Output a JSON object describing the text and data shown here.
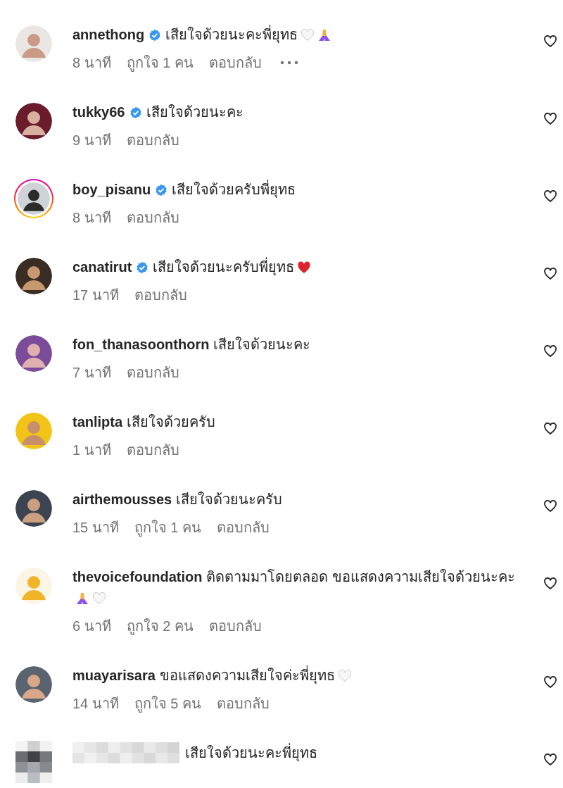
{
  "comments": [
    {
      "username": "annethong",
      "verified": true,
      "story_ring": false,
      "text": "เสียใจด้วยนะคะพี่ยุทธ",
      "emojis": [
        {
          "kind": "white-heart"
        },
        {
          "kind": "folded-hands"
        }
      ],
      "time": "8 นาที",
      "likes": "ถูกใจ 1 คน",
      "reply": "ตอบกลับ",
      "more_menu": true
    },
    {
      "username": "tukky66",
      "verified": true,
      "story_ring": false,
      "text": "เสียใจด้วยนะคะ",
      "time": "9 นาที",
      "reply": "ตอบกลับ",
      "more_menu": false
    },
    {
      "username": "boy_pisanu",
      "verified": true,
      "story_ring": true,
      "text": "เสียใจด้วยครับพี่ยุทธ",
      "time": "8 นาที",
      "reply": "ตอบกลับ",
      "more_menu": false
    },
    {
      "username": "canatirut",
      "verified": true,
      "story_ring": false,
      "text": "เสียใจด้วยนะครับพี่ยุทธ",
      "emojis": [
        {
          "kind": "red-heart"
        }
      ],
      "time": "17 นาที",
      "reply": "ตอบกลับ",
      "more_menu": false
    },
    {
      "username": "fon_thanasoonthorn",
      "verified": false,
      "story_ring": false,
      "text": "เสียใจด้วยนะคะ",
      "time": "7 นาที",
      "reply": "ตอบกลับ",
      "more_menu": false
    },
    {
      "username": "tanlipta",
      "verified": false,
      "story_ring": false,
      "text": "เสียใจด้วยครับ",
      "time": "1 นาที",
      "reply": "ตอบกลับ",
      "more_menu": false
    },
    {
      "username": "airthemousses",
      "verified": false,
      "story_ring": false,
      "text": "เสียใจด้วยนะครับ",
      "time": "15 นาที",
      "likes": "ถูกใจ 1 คน",
      "reply": "ตอบกลับ",
      "more_menu": false
    },
    {
      "username": "thevoicefoundation",
      "verified": false,
      "story_ring": false,
      "text": "ติดตามมาโดยตลอด ขอแสดงความเสียใจด้วยนะคะ",
      "emojis": [
        {
          "kind": "folded-hands"
        },
        {
          "kind": "white-heart"
        }
      ],
      "time": "6 นาที",
      "likes": "ถูกใจ 2 คน",
      "reply": "ตอบกลับ",
      "more_menu": false
    },
    {
      "username": "muayarisara",
      "verified": false,
      "story_ring": false,
      "text": "ขอแสดงความเสียใจค่ะพี่ยุทธ",
      "emojis": [
        {
          "kind": "white-heart"
        }
      ],
      "time": "14 นาที",
      "likes": "ถูกใจ 5 คน",
      "reply": "ตอบกลับ",
      "more_menu": false
    },
    {
      "username_hidden": true,
      "avatar_hidden": true,
      "verified": false,
      "story_ring": false,
      "text": "เสียใจด้วยนะคะพี่ยุทธ",
      "more_menu": false
    }
  ]
}
